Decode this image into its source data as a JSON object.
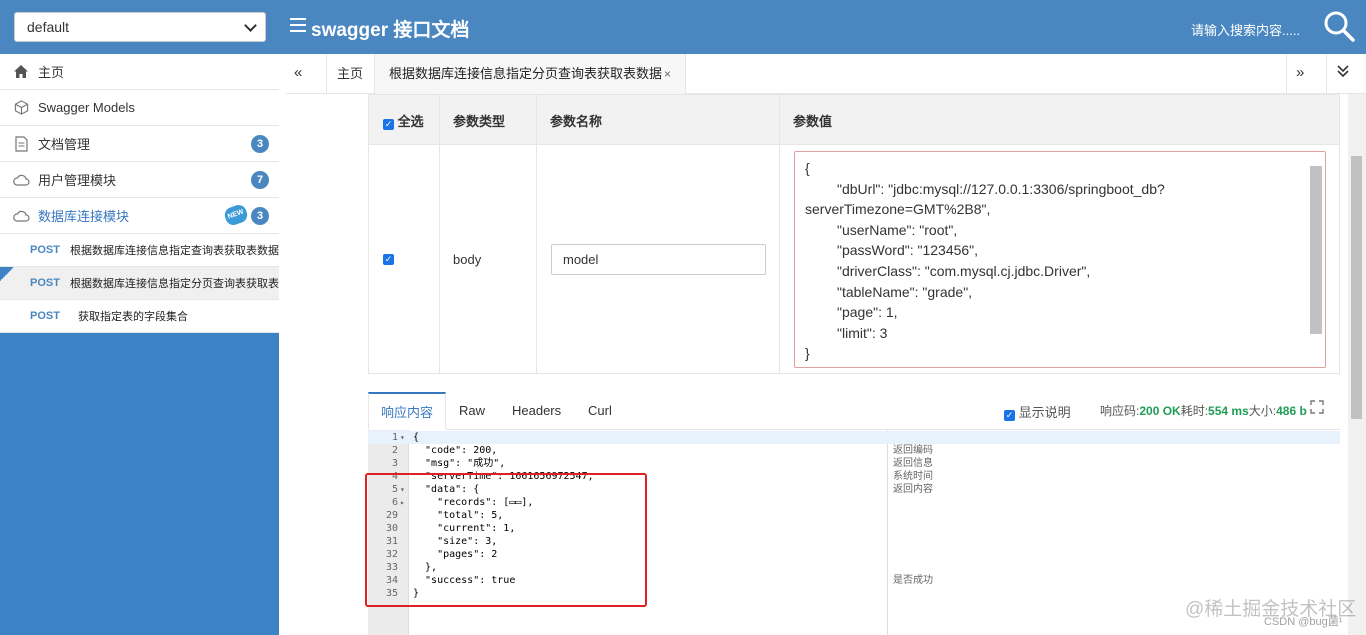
{
  "header": {
    "group_select": "default",
    "title": "swagger 接口文档",
    "search_placeholder": "请输入搜索内容....."
  },
  "sidebar": {
    "items": [
      {
        "label": "主页",
        "icon": "home-icon"
      },
      {
        "label": "Swagger Models",
        "icon": "cube-icon"
      },
      {
        "label": "文档管理",
        "icon": "document-icon",
        "badge": "3"
      },
      {
        "label": "用户管理模块",
        "icon": "cloud-icon",
        "badge": "7"
      },
      {
        "label": "数据库连接模块",
        "icon": "cloud-icon",
        "badge": "3",
        "tag": "NEW"
      }
    ],
    "apis": [
      {
        "method": "POST",
        "label": "根据数据库连接信息指定查询表获取表数据"
      },
      {
        "method": "POST",
        "label": "根据数据库连接信息指定分页查询表获取表"
      },
      {
        "method": "POST",
        "label": "获取指定表的字段集合"
      }
    ]
  },
  "tabs": {
    "home": "主页",
    "active": "根据数据库连接信息指定分页查询表获取表数据",
    "close": "×"
  },
  "params": {
    "headers": {
      "select_all": "全选",
      "type": "参数类型",
      "name": "参数名称",
      "value": "参数值"
    },
    "row": {
      "type": "body",
      "name": "model"
    },
    "json_lines": [
      "{",
      "\"dbUrl\": \"jdbc:mysql://127.0.0.1:3306/springboot_db?",
      "serverTimezone=GMT%2B8\",",
      "\"userName\": \"root\",",
      "\"passWord\": \"123456\",",
      "\"driverClass\": \"com.mysql.cj.jdbc.Driver\",",
      "\"tableName\": \"grade\",",
      "\"page\": 1,",
      "\"limit\": 3",
      "}"
    ]
  },
  "response": {
    "tabs": [
      "响应内容",
      "Raw",
      "Headers",
      "Curl"
    ],
    "show_desc": "显示说明",
    "code_label": "响应码:",
    "code_value": "200 OK",
    "time_label": "耗时:",
    "time_value": "554 ms",
    "size_label": "大小:",
    "size_value": "486 b",
    "lines": [
      {
        "n": "1",
        "fold": "▾",
        "code": "{",
        "desc": ""
      },
      {
        "n": "2",
        "fold": "",
        "code": "  \"code\": 200,",
        "desc": "返回编码"
      },
      {
        "n": "3",
        "fold": "",
        "code": "  \"msg\": \"成功\",",
        "desc": "返回信息"
      },
      {
        "n": "4",
        "fold": "",
        "code": "  \"serverTime\": 1661656972547,",
        "desc": "系统时间"
      },
      {
        "n": "5",
        "fold": "▾",
        "code": "  \"data\": {",
        "desc": "返回内容"
      },
      {
        "n": "6",
        "fold": "▸",
        "code": "    \"records\": [▭▭],",
        "desc": ""
      },
      {
        "n": "29",
        "fold": "",
        "code": "    \"total\": 5,",
        "desc": ""
      },
      {
        "n": "30",
        "fold": "",
        "code": "    \"current\": 1,",
        "desc": ""
      },
      {
        "n": "31",
        "fold": "",
        "code": "    \"size\": 3,",
        "desc": ""
      },
      {
        "n": "32",
        "fold": "",
        "code": "    \"pages\": 2",
        "desc": ""
      },
      {
        "n": "33",
        "fold": "",
        "code": "  },",
        "desc": ""
      },
      {
        "n": "34",
        "fold": "",
        "code": "  \"success\": true",
        "desc": "是否成功"
      },
      {
        "n": "35",
        "fold": "",
        "code": "}",
        "desc": ""
      }
    ]
  },
  "watermark": {
    "main": "@稀土掘金技术社区",
    "csdn": "CSDN @bug菌¹"
  },
  "colors": {
    "header_bg": "#4a87c0",
    "sidebar_bg": "#3b83c4",
    "accent": "#3778c2",
    "highlight_box": "#e02020"
  }
}
